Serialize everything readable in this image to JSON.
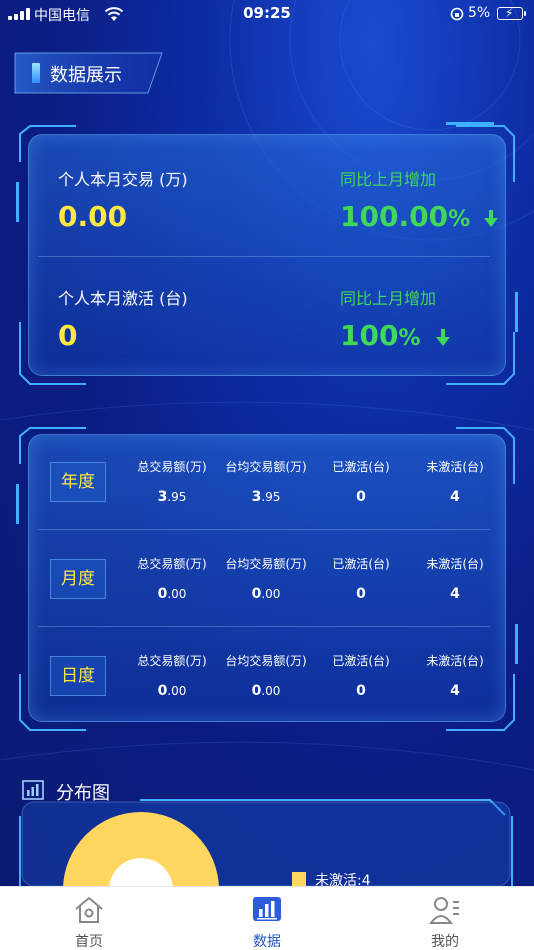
{
  "status_bar": {
    "carrier": "中国电信",
    "time": "09:25",
    "battery_percent": "5%"
  },
  "section_title": "数据展示",
  "summary": {
    "rows": [
      {
        "label": "个人本月交易 (万)",
        "value": "0.00",
        "compare_label": "同比上月增加",
        "compare_value": "100.00",
        "compare_unit": "%",
        "trend_icon": "arrow-down-icon"
      },
      {
        "label": "个人本月激活 (台)",
        "value": "0",
        "compare_label": "同比上月增加",
        "compare_value": "100",
        "compare_unit": "%",
        "trend_icon": "arrow-down-icon"
      }
    ]
  },
  "table": {
    "columns": [
      "总交易额(万)",
      "台均交易额(万)",
      "已激活(台)",
      "未激活(台)"
    ],
    "rows": [
      {
        "period": "年度",
        "total_main": "3",
        "total_dec": ".95",
        "avg_main": "3",
        "avg_dec": ".95",
        "activated": "0",
        "inactive": "4"
      },
      {
        "period": "月度",
        "total_main": "0",
        "total_dec": ".00",
        "avg_main": "0",
        "avg_dec": ".00",
        "activated": "0",
        "inactive": "4"
      },
      {
        "period": "日度",
        "total_main": "0",
        "total_dec": ".00",
        "avg_main": "0",
        "avg_dec": ".00",
        "activated": "0",
        "inactive": "4"
      }
    ]
  },
  "distribution": {
    "title": "分布图",
    "legend": [
      {
        "label": "未激活:4",
        "color": "#ffd660"
      }
    ]
  },
  "tabbar": {
    "items": [
      {
        "label": "首页",
        "icon": "home-icon",
        "active": false
      },
      {
        "label": "数据",
        "icon": "chart-icon",
        "active": true
      },
      {
        "label": "我的",
        "icon": "profile-icon",
        "active": false
      }
    ]
  },
  "colors": {
    "accent_yellow": "#ffe93f",
    "accent_green": "#3fd85a",
    "tab_active": "#2454c8",
    "pie_inactive": "#ffd660"
  }
}
